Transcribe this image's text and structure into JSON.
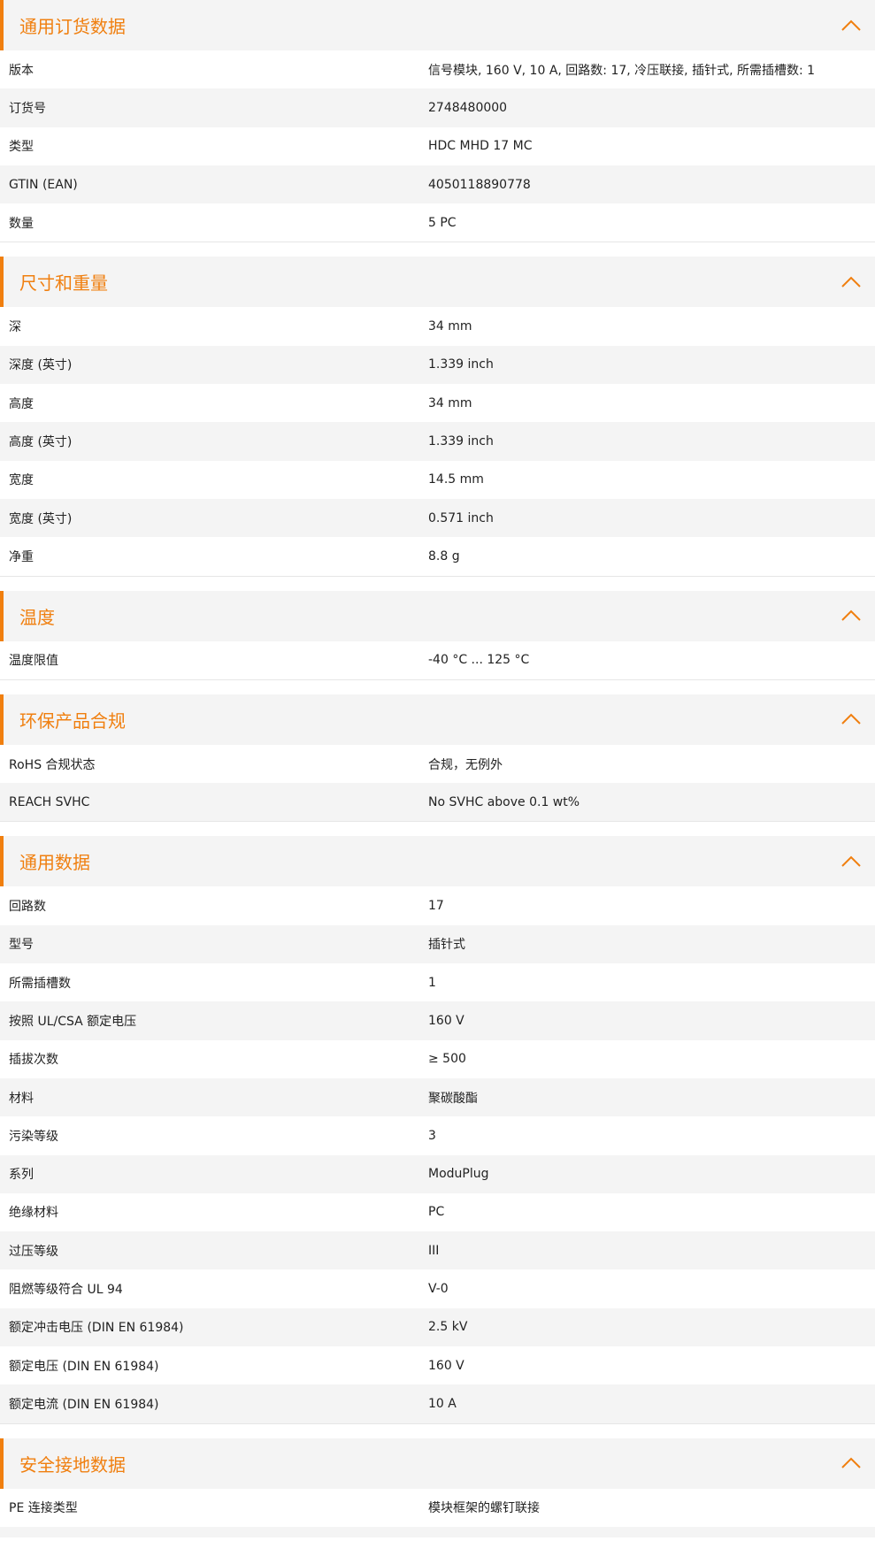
{
  "accent": "#f07f0f",
  "sections": [
    {
      "title": "通用订货数据",
      "rows": [
        {
          "label": "版本",
          "value": "信号模块, 160 V, 10 A, 回路数: 17, 冷压联接, 插针式, 所需插槽数: 1"
        },
        {
          "label": "订货号",
          "value": "2748480000"
        },
        {
          "label": "类型",
          "value": "HDC MHD 17 MC"
        },
        {
          "label": "GTIN (EAN)",
          "value": "4050118890778"
        },
        {
          "label": "数量",
          "value": "5  PC"
        }
      ]
    },
    {
      "title": "尺寸和重量",
      "rows": [
        {
          "label": "深",
          "value": "34  mm"
        },
        {
          "label": "深度 (英寸)",
          "value": "1.339  inch"
        },
        {
          "label": "高度",
          "value": "34  mm"
        },
        {
          "label": "高度 (英寸)",
          "value": "1.339  inch"
        },
        {
          "label": "宽度",
          "value": "14.5  mm"
        },
        {
          "label": "宽度 (英寸)",
          "value": "0.571  inch"
        },
        {
          "label": "净重",
          "value": "8.8  g"
        }
      ]
    },
    {
      "title": "温度",
      "rows": [
        {
          "label": "温度限值",
          "value": "-40 °C ... 125 °C"
        }
      ]
    },
    {
      "title": "环保产品合规",
      "rows": [
        {
          "label": "RoHS 合规状态",
          "value": "合规，无例外"
        },
        {
          "label": "REACH SVHC",
          "value": "No SVHC above 0.1 wt%"
        }
      ]
    },
    {
      "title": "通用数据",
      "rows": [
        {
          "label": "回路数",
          "value": "17"
        },
        {
          "label": "型号",
          "value": "插针式"
        },
        {
          "label": "所需插槽数",
          "value": "1"
        },
        {
          "label": "按照 UL/CSA 额定电压",
          "value": "160 V"
        },
        {
          "label": "插拔次数",
          "value": "≥ 500"
        },
        {
          "label": "材料",
          "value": "聚碳酸酯"
        },
        {
          "label": "污染等级",
          "value": "3"
        },
        {
          "label": "系列",
          "value": "ModuPlug"
        },
        {
          "label": "绝缘材料",
          "value": "PC"
        },
        {
          "label": "过压等级",
          "value": "III"
        },
        {
          "label": "阻燃等级符合 UL 94",
          "value": "V-0"
        },
        {
          "label": "额定冲击电压 (DIN EN 61984)",
          "value": "2.5  kV"
        },
        {
          "label": "额定电压 (DIN EN 61984)",
          "value": "160  V"
        },
        {
          "label": "额定电流 (DIN EN 61984)",
          "value": "10  A"
        }
      ]
    },
    {
      "title": "安全接地数据",
      "rows": [
        {
          "label": "PE 连接类型",
          "value": "模块框架的螺钉联接"
        }
      ]
    }
  ],
  "icons": {
    "toggle": "chevron-up-icon"
  }
}
